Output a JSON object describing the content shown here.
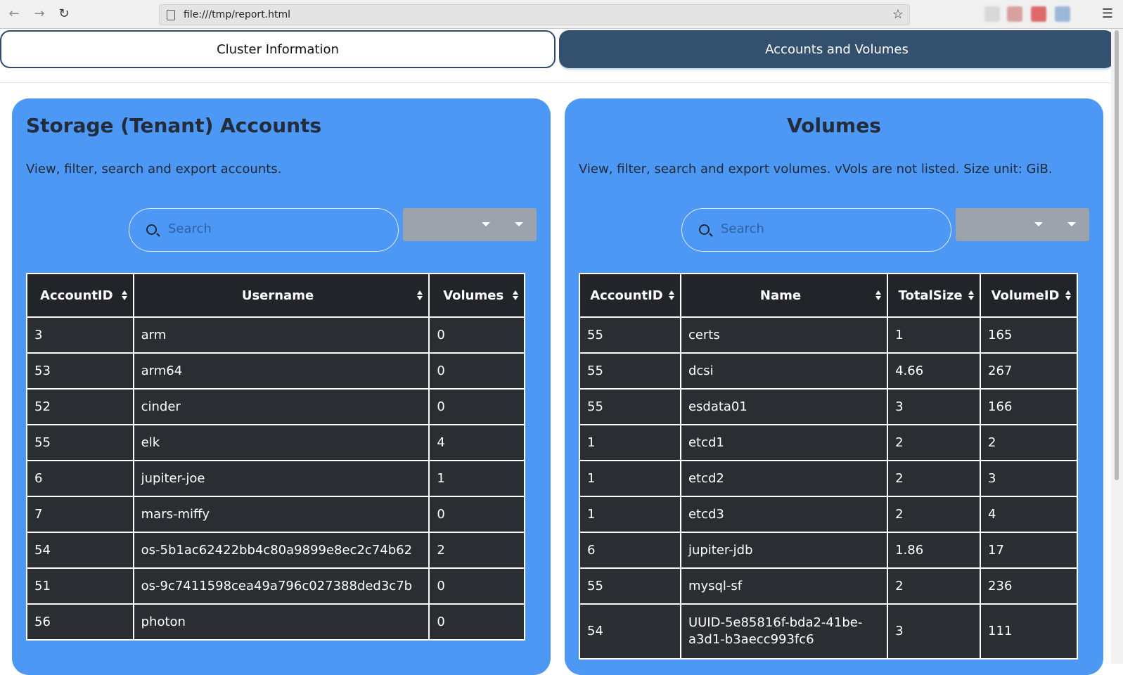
{
  "browser": {
    "url": "file:///tmp/report.html"
  },
  "tabs": [
    {
      "label": "Cluster Information",
      "active": false
    },
    {
      "label": "Accounts and Volumes",
      "active": true
    }
  ],
  "accounts": {
    "title": "Storage (Tenant) Accounts",
    "description": "View, filter, search and export accounts.",
    "search_placeholder": "Search",
    "columns": [
      "AccountID",
      "Username",
      "Volumes"
    ],
    "rows": [
      [
        "3",
        "arm",
        "0"
      ],
      [
        "53",
        "arm64",
        "0"
      ],
      [
        "52",
        "cinder",
        "0"
      ],
      [
        "55",
        "elk",
        "4"
      ],
      [
        "6",
        "jupiter-joe",
        "1"
      ],
      [
        "7",
        "mars-miffy",
        "0"
      ],
      [
        "54",
        "os-5b1ac62422bb4c80a9899e8ec2c74b62",
        "2"
      ],
      [
        "51",
        "os-9c7411598cea49a796c027388ded3c7b",
        "0"
      ],
      [
        "56",
        "photon",
        "0"
      ]
    ]
  },
  "volumes": {
    "title": "Volumes",
    "description": "View, filter, search and export volumes. vVols are not listed. Size unit: GiB.",
    "search_placeholder": "Search",
    "columns": [
      "AccountID",
      "Name",
      "TotalSize",
      "VolumeID"
    ],
    "rows": [
      [
        "55",
        "certs",
        "1",
        "165"
      ],
      [
        "55",
        "dcsi",
        "4.66",
        "267"
      ],
      [
        "55",
        "esdata01",
        "3",
        "166"
      ],
      [
        "1",
        "etcd1",
        "2",
        "2"
      ],
      [
        "1",
        "etcd2",
        "2",
        "3"
      ],
      [
        "1",
        "etcd3",
        "2",
        "4"
      ],
      [
        "6",
        "jupiter-jdb",
        "1.86",
        "17"
      ],
      [
        "55",
        "mysql-sf",
        "2",
        "236"
      ],
      [
        "54",
        "UUID-5e85816f-bda2-41be-a3d1-b3aecc993fc6",
        "3",
        "111"
      ]
    ]
  },
  "colors": {
    "panel": "#4d97f5",
    "active_tab": "#34506f",
    "table_bg": "#212529"
  }
}
